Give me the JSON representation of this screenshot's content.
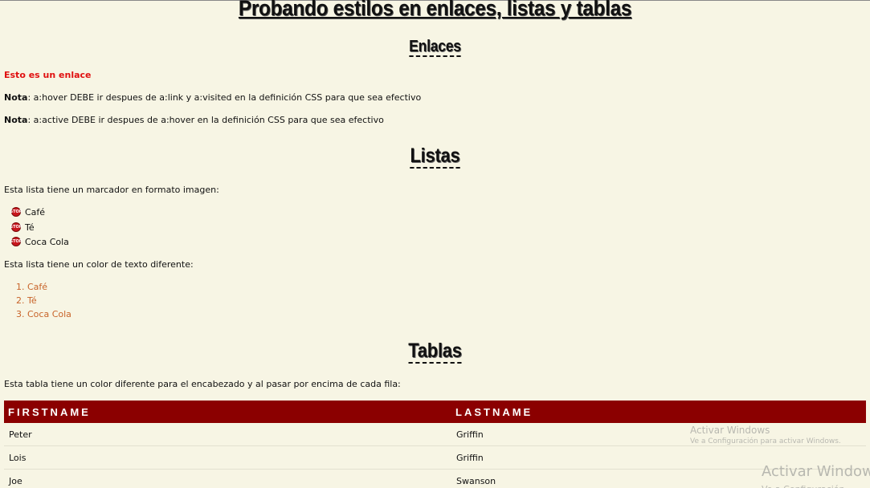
{
  "page": {
    "title": "Probando estilos en enlaces, listas y tablas"
  },
  "sections": {
    "links": {
      "heading": "Enlaces",
      "link_text": "Esto es un enlace",
      "note1_label": "Nota",
      "note1_text": ": a:hover DEBE ir despues de a:link y a:visited en la definición CSS para que sea efectivo",
      "note2_label": "Nota",
      "note2_text": ": a:active DEBE ir despues de a:hover en la definición CSS para que sea efectivo"
    },
    "lists": {
      "heading": "Listas",
      "intro_image_marker": "Esta lista tiene un marcador en formato imagen:",
      "image_list": [
        "Café",
        "Té",
        "Coca Cola"
      ],
      "marker_icon": "stop-sign-icon",
      "marker_text": "STOP",
      "intro_colored": "Esta lista tiene un color de texto diferente:",
      "colored_list": [
        "Café",
        "Té",
        "Coca Cola"
      ],
      "colored_list_numbers": [
        "1.",
        "2.",
        "3."
      ],
      "colored_list_color": "#c8642a"
    },
    "tables": {
      "heading": "Tablas",
      "intro": "Esta tabla tiene un color diferente para el encabezado y al pasar por encima de cada fila:",
      "header_color": "#8b0000",
      "columns": [
        "FIRSTNAME",
        "LASTNAME"
      ],
      "rows": [
        [
          "Peter",
          "Griffin"
        ],
        [
          "Lois",
          "Griffin"
        ],
        [
          "Joe",
          "Swanson"
        ]
      ]
    }
  },
  "watermark": {
    "small_title": "Activar Windows",
    "small_sub": "Ve a Configuración para activar Windows.",
    "large_title": "Activar Window",
    "large_sub": "Ve a Configuración"
  },
  "colors": {
    "background": "#f7f5e4",
    "link": "#e01010"
  }
}
